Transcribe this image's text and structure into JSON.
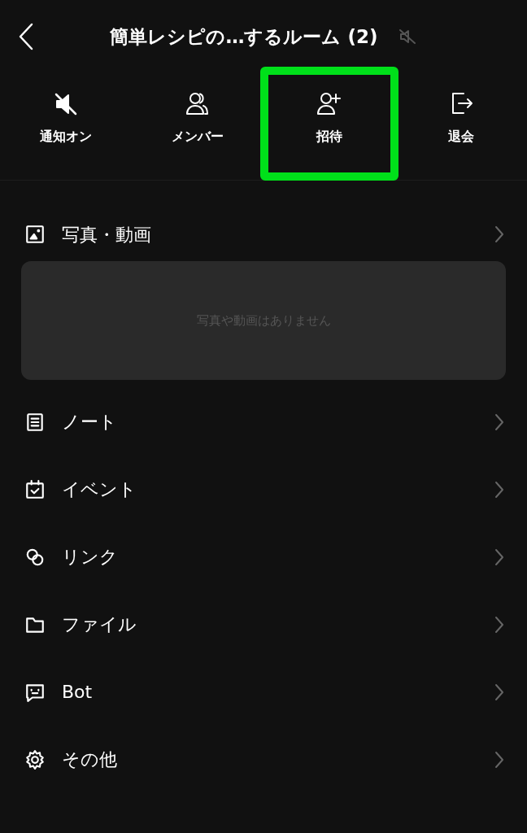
{
  "header": {
    "title": "簡単レシピの…するルーム (2)",
    "muted": true
  },
  "actions": [
    {
      "label": "通知オン",
      "highlighted": false
    },
    {
      "label": "メンバー",
      "highlighted": false
    },
    {
      "label": "招待",
      "highlighted": true
    },
    {
      "label": "退会",
      "highlighted": false
    }
  ],
  "menu": [
    {
      "kind": "media",
      "label": "写真・動画",
      "empty_text": "写真や動画はありません"
    },
    {
      "kind": "plain",
      "label": "ノート"
    },
    {
      "kind": "plain",
      "label": "イベント"
    },
    {
      "kind": "plain",
      "label": "リンク"
    },
    {
      "kind": "plain",
      "label": "ファイル"
    },
    {
      "kind": "plain",
      "label": "Bot"
    },
    {
      "kind": "plain",
      "label": "その他"
    }
  ]
}
